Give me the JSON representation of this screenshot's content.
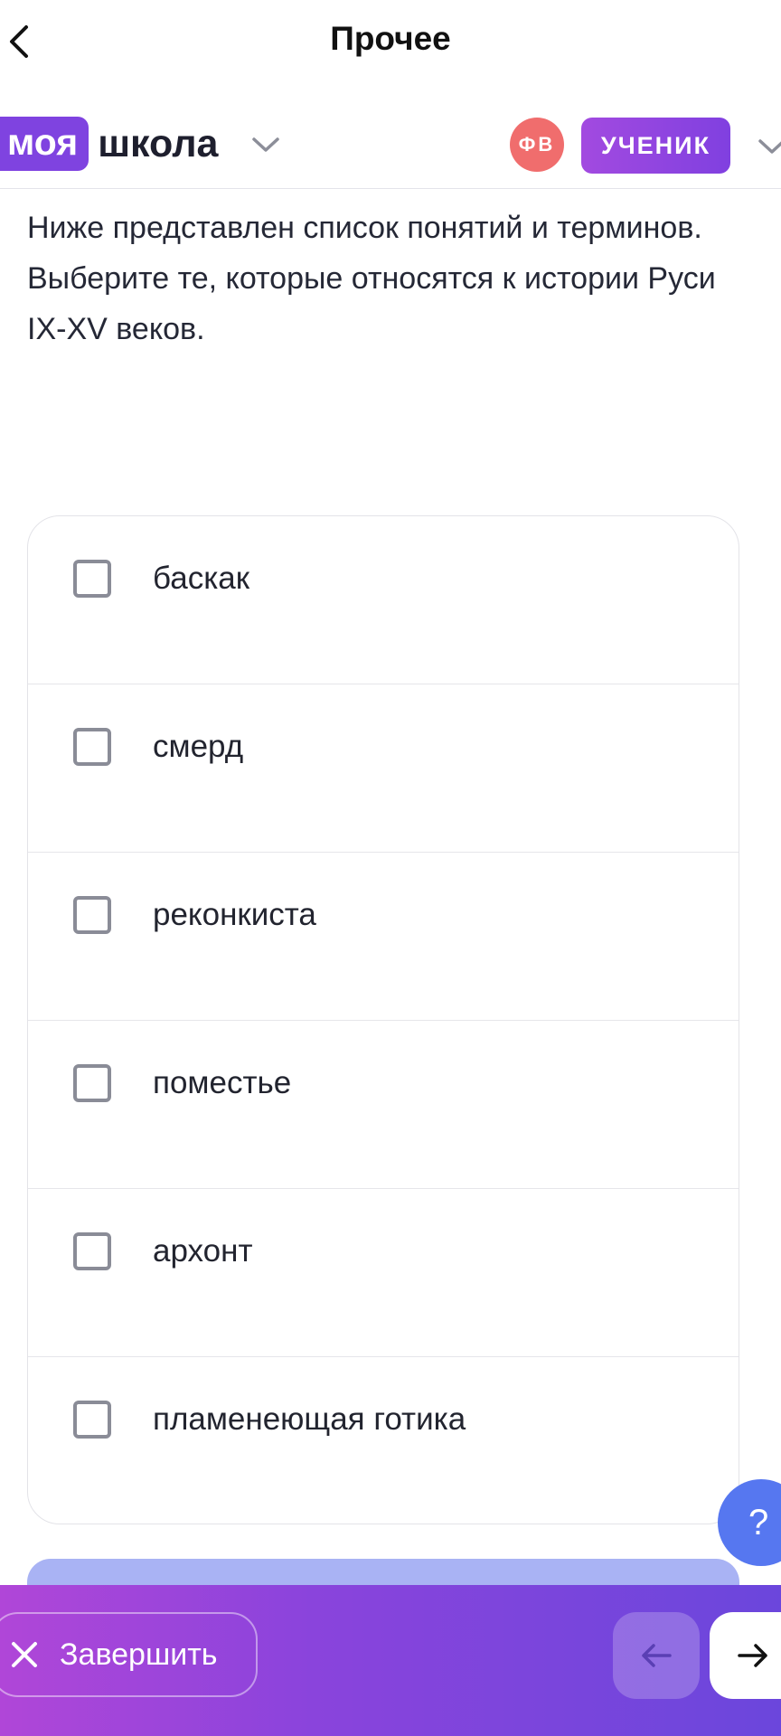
{
  "navbar": {
    "title": "Прочее",
    "back_icon": "chevron-left-icon"
  },
  "header": {
    "logo_part1": "моя",
    "logo_part2": "школа",
    "avatar_initials": "ФВ",
    "role": "УЧЕНИК"
  },
  "question": {
    "text": "Ниже представлен список понятий и терминов. Выберите те, которые относятся к истории Руси IX-XV веков."
  },
  "options": [
    {
      "label": "баскак",
      "checked": false
    },
    {
      "label": "смерд",
      "checked": false
    },
    {
      "label": "реконкиста",
      "checked": false
    },
    {
      "label": "поместье",
      "checked": false
    },
    {
      "label": "архонт",
      "checked": false
    },
    {
      "label": "пламенеющая готика",
      "checked": false
    }
  ],
  "help": {
    "label": "?"
  },
  "bottom_bar": {
    "finish_label": "Завершить",
    "prev_icon": "arrow-left-icon",
    "next_icon": "arrow-right-icon"
  },
  "colors": {
    "brand_purple": "#7f43e0",
    "avatar_red": "#f06d6d",
    "help_blue": "#5677f0",
    "submit_disabled": "#a9b3f4"
  }
}
